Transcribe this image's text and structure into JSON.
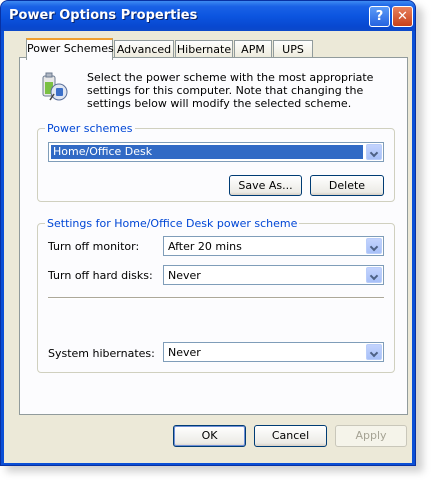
{
  "window": {
    "title": "Power Options Properties"
  },
  "titlebar": {
    "help_glyph": "?",
    "close_glyph": "✕"
  },
  "tabs": [
    {
      "label": "Power Schemes",
      "active": true
    },
    {
      "label": "Advanced",
      "active": false
    },
    {
      "label": "Hibernate",
      "active": false
    },
    {
      "label": "APM",
      "active": false
    },
    {
      "label": "UPS",
      "active": false
    }
  ],
  "intro": {
    "icon": "power-options-icon",
    "text": "Select the power scheme with the most appropriate settings for this computer. Note that changing the settings below will modify the selected scheme."
  },
  "power_schemes": {
    "group_title": "Power schemes",
    "selected": "Home/Office Desk",
    "save_as_label": "Save As...",
    "delete_label": "Delete"
  },
  "settings": {
    "group_title": "Settings for Home/Office Desk power scheme",
    "monitor_label": "Turn off monitor:",
    "monitor_value": "After 20 mins",
    "disks_label": "Turn off hard disks:",
    "disks_value": "Never",
    "hibernate_label": "System hibernates:",
    "hibernate_value": "Never"
  },
  "footer": {
    "ok_label": "OK",
    "cancel_label": "Cancel",
    "apply_label": "Apply"
  }
}
